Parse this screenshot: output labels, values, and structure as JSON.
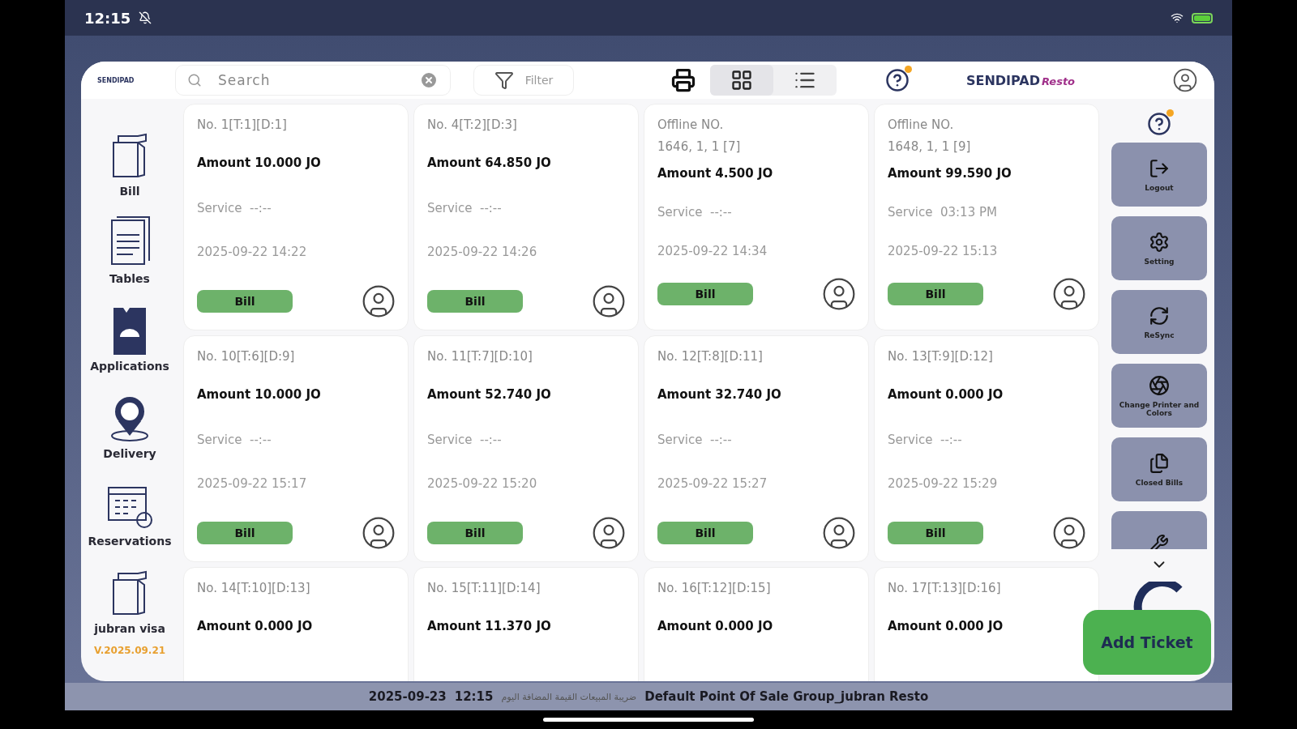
{
  "status_bar": {
    "time": "12:15"
  },
  "app": {
    "logo": "SENDIPAD",
    "brand": "SENDIPAD",
    "brand_suffix": "Resto"
  },
  "search": {
    "placeholder": "Search"
  },
  "filter": {
    "label": "Filter"
  },
  "view_toggle": [
    {
      "kind": "grid",
      "selected": true
    },
    {
      "kind": "list",
      "selected": false
    }
  ],
  "sidebar": {
    "items": [
      {
        "label": "Bill"
      },
      {
        "label": "Tables"
      },
      {
        "label": "Applications"
      },
      {
        "label": "Delivery"
      },
      {
        "label": "Reservations"
      },
      {
        "label": "jubran visa"
      }
    ],
    "version": "V.2025.09.21"
  },
  "tickets": [
    {
      "title": "No. 1[T:1][D:1]",
      "amount": "Amount 10.000 JO",
      "service_label": "Service",
      "service_time": "--:--",
      "date": "2025-09-22 14:22",
      "button": "Bill"
    },
    {
      "title": "No. 4[T:2][D:3]",
      "amount": "Amount 64.850 JO",
      "service_label": "Service",
      "service_time": "--:--",
      "date": "2025-09-22 14:26",
      "button": "Bill"
    },
    {
      "title": "Offline NO.\n1646, 1, 1 [7]",
      "amount": "Amount 4.500 JO",
      "service_label": "Service",
      "service_time": "--:--",
      "date": "2025-09-22 14:34",
      "button": "Bill"
    },
    {
      "title": "Offline NO.\n1648, 1, 1 [9]",
      "amount": "Amount 99.590 JO",
      "service_label": "Service",
      "service_time": "03:13 PM",
      "date": "2025-09-22 15:13",
      "button": "Bill"
    },
    {
      "title": "No. 10[T:6][D:9]",
      "amount": "Amount 10.000 JO",
      "service_label": "Service",
      "service_time": "--:--",
      "date": "2025-09-22 15:17",
      "button": "Bill"
    },
    {
      "title": "No. 11[T:7][D:10]",
      "amount": "Amount 52.740 JO",
      "service_label": "Service",
      "service_time": "--:--",
      "date": "2025-09-22 15:20",
      "button": "Bill"
    },
    {
      "title": "No. 12[T:8][D:11]",
      "amount": "Amount 32.740 JO",
      "service_label": "Service",
      "service_time": "--:--",
      "date": "2025-09-22 15:27",
      "button": "Bill"
    },
    {
      "title": "No. 13[T:9][D:12]",
      "amount": "Amount 0.000 JO",
      "service_label": "Service",
      "service_time": "--:--",
      "date": "2025-09-22 15:29",
      "button": "Bill"
    },
    {
      "title": "No. 14[T:10][D:13]",
      "amount": "Amount 0.000 JO"
    },
    {
      "title": "No. 15[T:11][D:14]",
      "amount": "Amount 11.370 JO"
    },
    {
      "title": "No. 16[T:12][D:15]",
      "amount": "Amount 0.000 JO"
    },
    {
      "title": "No. 17[T:13][D:16]",
      "amount": "Amount 0.000 JO"
    }
  ],
  "actions": [
    {
      "label": "Logout"
    },
    {
      "label": "Setting"
    },
    {
      "label": "ReSync"
    },
    {
      "label": "Change Printer and Colors"
    },
    {
      "label": "Closed Bills"
    }
  ],
  "add_ticket": {
    "label": "Add Ticket"
  },
  "footer": {
    "date": "2025-09-23",
    "time": "12:15",
    "note": "ضريبة المبيعات القيمة المضافة اليوم",
    "group": "Default Point Of Sale Group_jubran Resto"
  }
}
